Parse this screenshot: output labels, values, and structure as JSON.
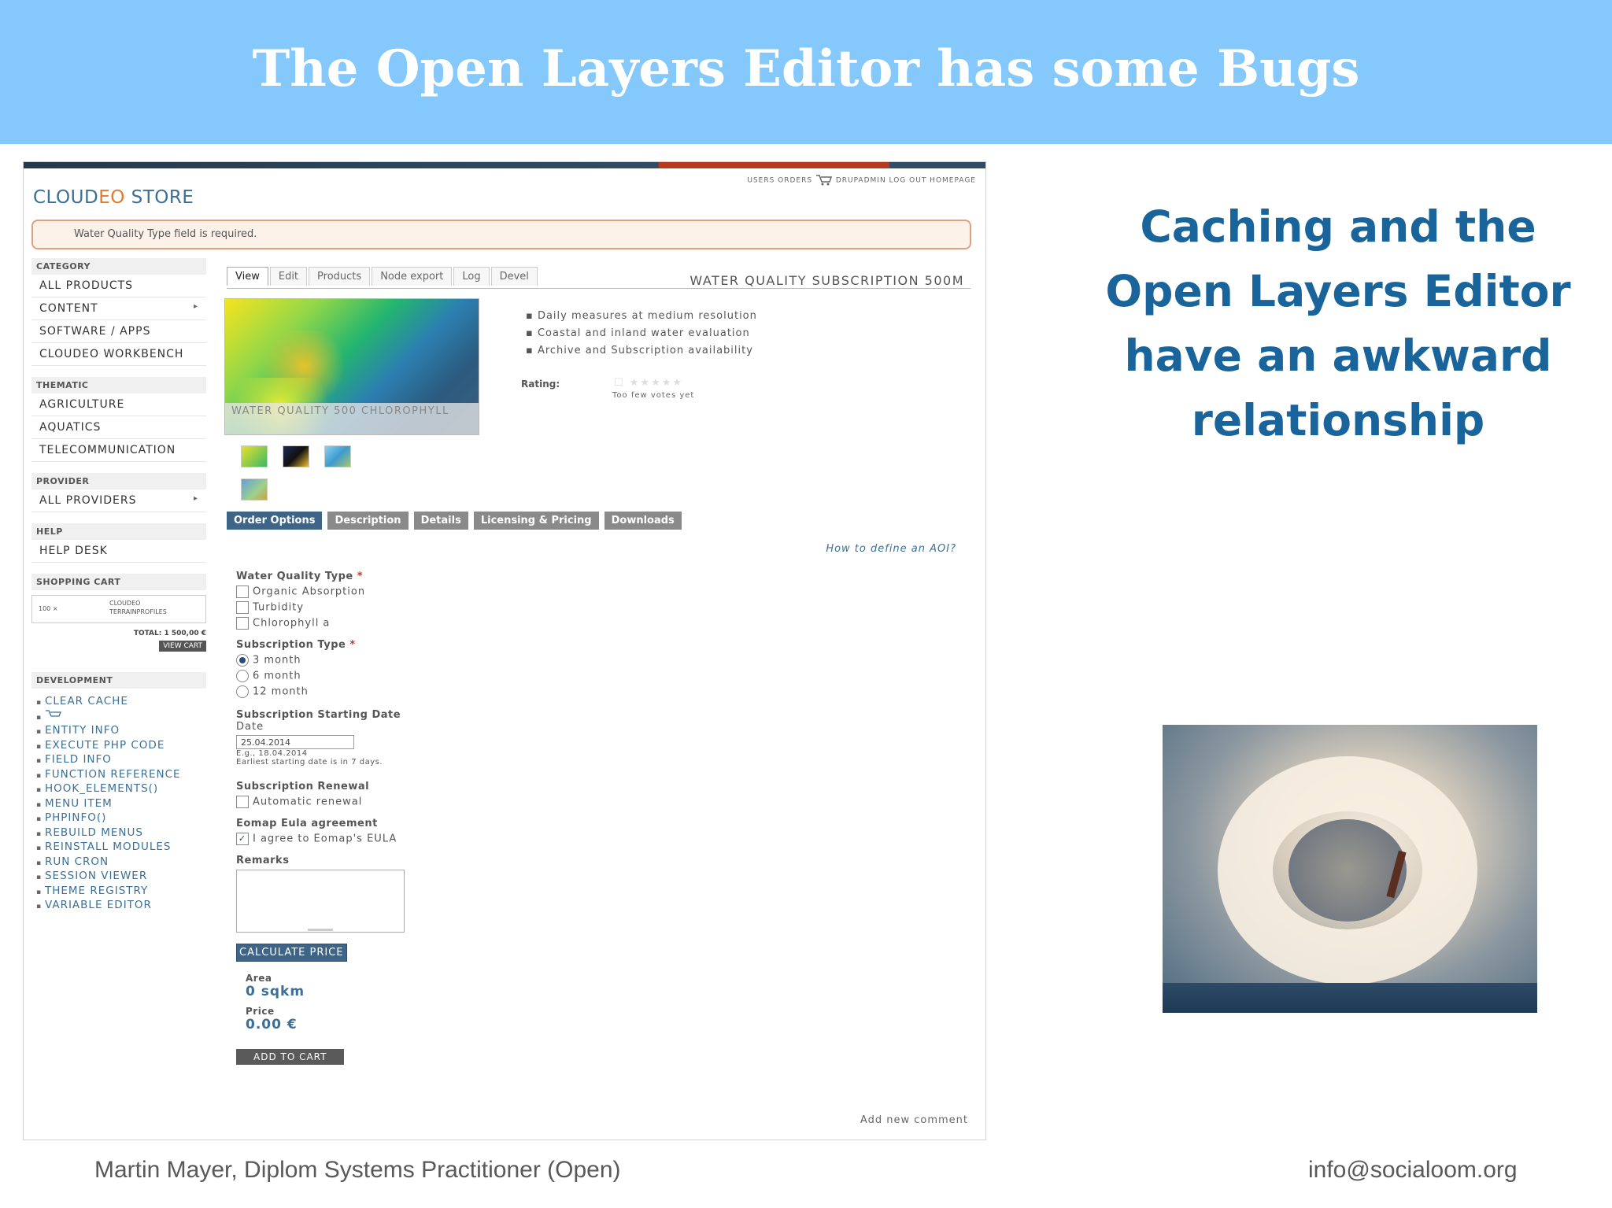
{
  "slide": {
    "title": "The Open Layers Editor has some Bugs",
    "side_heading": "Caching and the Open Layers Editor have an awkward relationship",
    "footer_left": "Martin Mayer, Diplom Systems Practitioner (Open)",
    "footer_right": "info@socialoom.org",
    "colors": {
      "banner": "#85c8fb",
      "heading": "#19659b",
      "footer": "#595959"
    }
  },
  "shot": {
    "logo_a": "CLOUD",
    "logo_b": "EO",
    "logo_c": " STORE",
    "top_links": "USERS ORDERS",
    "top_links_2": "DRUPADMIN LOG OUT HOMEPAGE",
    "error": "Water Quality Type field is required.",
    "nav": {
      "category": "CATEGORY",
      "category_items": [
        "ALL PRODUCTS",
        "CONTENT",
        "SOFTWARE / APPS",
        "CLOUDEO WORKBENCH"
      ],
      "thematic": "THEMATIC",
      "thematic_items": [
        "AGRICULTURE",
        "AQUATICS",
        "TELECOMMUNICATION"
      ],
      "provider": "PROVIDER",
      "provider_items": [
        "ALL PROVIDERS"
      ],
      "help": "HELP",
      "help_items": [
        "HELP DESK"
      ],
      "shopping_cart": "SHOPPING CART",
      "cart_qty": "100 ×",
      "cart_name": "CLOUDEO TERRAINPROFILES",
      "cart_total": "TOTAL: 1 500,00 €",
      "view_cart": "VIEW CART",
      "development": "DEVELOPMENT",
      "dev_items": [
        "CLEAR CACHE",
        "",
        "ENTITY INFO",
        "EXECUTE PHP CODE",
        "FIELD INFO",
        "FUNCTION REFERENCE",
        "HOOK_ELEMENTS()",
        "MENU ITEM",
        "PHPINFO()",
        "REBUILD MENUS",
        "REINSTALL MODULES",
        "RUN CRON",
        "SESSION VIEWER",
        "THEME REGISTRY",
        "VARIABLE EDITOR"
      ]
    },
    "tabs": [
      "View",
      "Edit",
      "Products",
      "Node export",
      "Log",
      "Devel"
    ],
    "product_title": "WATER QUALITY SUBSCRIPTION 500M",
    "image_caption": "WATER QUALITY 500 CHLOROPHYLL",
    "bullets": [
      "Daily measures at medium resolution",
      "Coastal and inland water evaluation",
      "Archive and Subscription availability"
    ],
    "rating_label": "Rating:",
    "stars": "☐ ★★★★★",
    "votes": "Too few votes yet",
    "subtabs": [
      "Order Options",
      "Description",
      "Details",
      "Licensing & Pricing",
      "Downloads"
    ],
    "aoi_link": "How to define an AOI?",
    "form": {
      "wq_label": "Water Quality Type",
      "wq_options": [
        "Organic Absorption",
        "Turbidity",
        "Chlorophyll a"
      ],
      "sub_label": "Subscription Type",
      "sub_options": [
        "3 month",
        "6 month",
        "12 month"
      ],
      "sub_selected": "3 month",
      "date_label": "Subscription Starting Date",
      "date_sub": "Date",
      "date_value": "25.04.2014",
      "date_hint1": "E.g., 18.04.2014",
      "date_hint2": "Earliest starting date is in 7 days.",
      "renewal_label": "Subscription Renewal",
      "renewal_option": "Automatic renewal",
      "renewal_checked": false,
      "eula_label": "Eomap Eula agreement",
      "eula_option": "I agree to Eomap's EULA",
      "eula_checked": true,
      "remarks_label": "Remarks",
      "calc_button": "CALCULATE PRICE",
      "area_label": "Area",
      "area_value": "0 sqkm",
      "price_label": "Price",
      "price_value": "0.00 €",
      "add_button": "ADD TO CART"
    },
    "add_comment": "Add new comment",
    "required_mark": "*"
  }
}
